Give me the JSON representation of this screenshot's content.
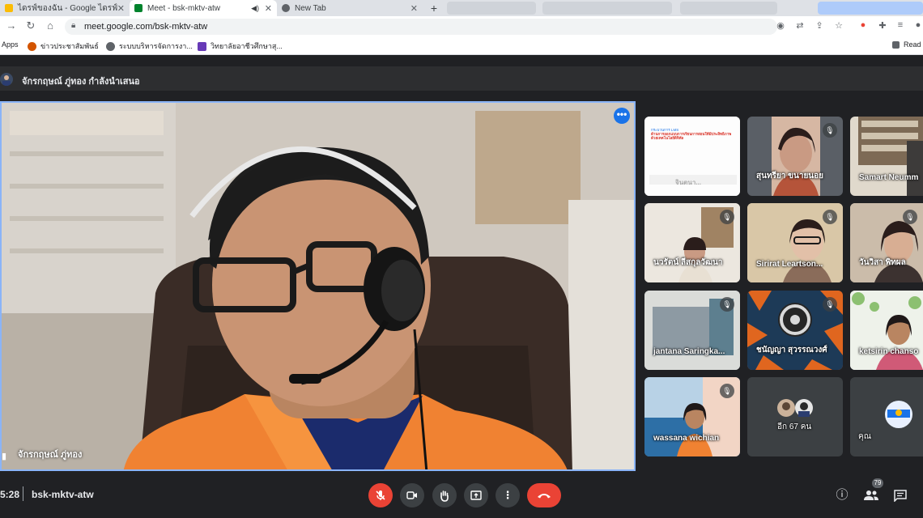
{
  "browser": {
    "tabs": [
      {
        "title": "ไดรฟ์ของฉัน - Google ไดรฟ์",
        "color": "#fbbc04"
      },
      {
        "title": "Meet - bsk-mktv-atw",
        "color": "#00832d"
      },
      {
        "title": "New Tab",
        "color": "#5f6368"
      }
    ],
    "url": "meet.google.com/bsk-mktv-atw",
    "bookmarks": [
      {
        "label": "Apps"
      },
      {
        "label": "ข่าวประชาสัมพันธ์"
      },
      {
        "label": "ระบบบริหารจัดการงา..."
      },
      {
        "label": "วิทยาลัยอาชีวศึกษาสุ..."
      },
      {
        "label": "Read"
      }
    ]
  },
  "meet": {
    "presenting_banner": "จักรกฤษณ์ ภู่ทอง กำลังนำเสนอ",
    "main_speaker": "จักรกฤษณ์ ภู่ทอง",
    "participants": [
      {
        "name": "จินตนา..."
      },
      {
        "name": "สุนทรียา ขนายนอย"
      },
      {
        "name": "Samart Neumm"
      },
      {
        "name": "นวรัตน์ ลีสกุลวัฒนา"
      },
      {
        "name": "Sirirat Leartson..."
      },
      {
        "name": "วันวิสา พิทผล"
      },
      {
        "name": "jantana Saringka..."
      },
      {
        "name": "ชนัญญา สุวรรณวงศ์"
      },
      {
        "name": "ketsirin chanso"
      },
      {
        "name": "wassana wichian"
      },
      {
        "name": "อีก 67 คน"
      },
      {
        "name": "คุณ"
      }
    ],
    "slide_lines": [
      "กระบวนการ LMS",
      "ด้านการออกแบบการเรียนการสอนให้มีประสิทธิภาพ",
      "ด้วยเทคโนโลยีดิจิทัล"
    ],
    "clock": "5:28",
    "meeting_code": "bsk-mktv-atw",
    "participant_count": "79"
  },
  "colors": {
    "accent_blue": "#8ab4f8",
    "danger_red": "#ea4335",
    "bar_bg": "#202124"
  }
}
